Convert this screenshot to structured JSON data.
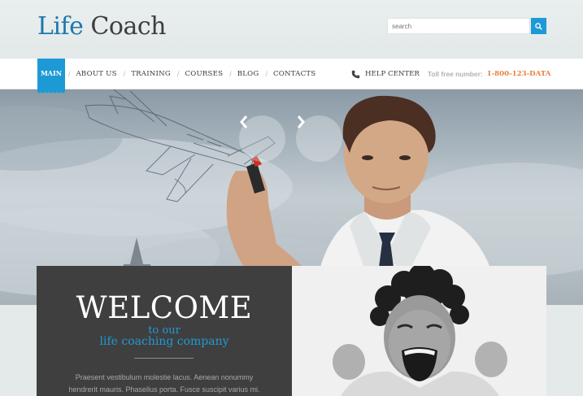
{
  "header": {
    "logo_word1": "Life",
    "logo_word2": "Coach",
    "search_placeholder": "search",
    "search_icon": "search-icon"
  },
  "nav": {
    "main_label": "MAIN",
    "items": [
      {
        "label": "ABOUT US"
      },
      {
        "label": "TRAINING"
      },
      {
        "label": "COURSES"
      },
      {
        "label": "BLOG"
      },
      {
        "label": "CONTACTS"
      }
    ],
    "separator": "/",
    "help_icon": "phone-icon",
    "help_label": "HELP CENTER",
    "toll_label": "Toll free number:",
    "toll_number": "1-800-123-DATA"
  },
  "slider": {
    "prev_icon": "chevron-left-icon",
    "next_icon": "chevron-right-icon"
  },
  "welcome": {
    "title": "WELCOME",
    "sub1": "to our",
    "sub2": "life coaching company",
    "body_line1": "Praesent vestibulum molestie lacus. Aenean nonummy",
    "body_line2": "hendrerit mauris. Phasellus porta. Fusce suscipit varius mi."
  },
  "colors": {
    "accent": "#1d9ad6",
    "logo_blue": "#1b79ad",
    "phone_orange": "#e8813c",
    "welcome_bg": "#3f3f3f"
  }
}
